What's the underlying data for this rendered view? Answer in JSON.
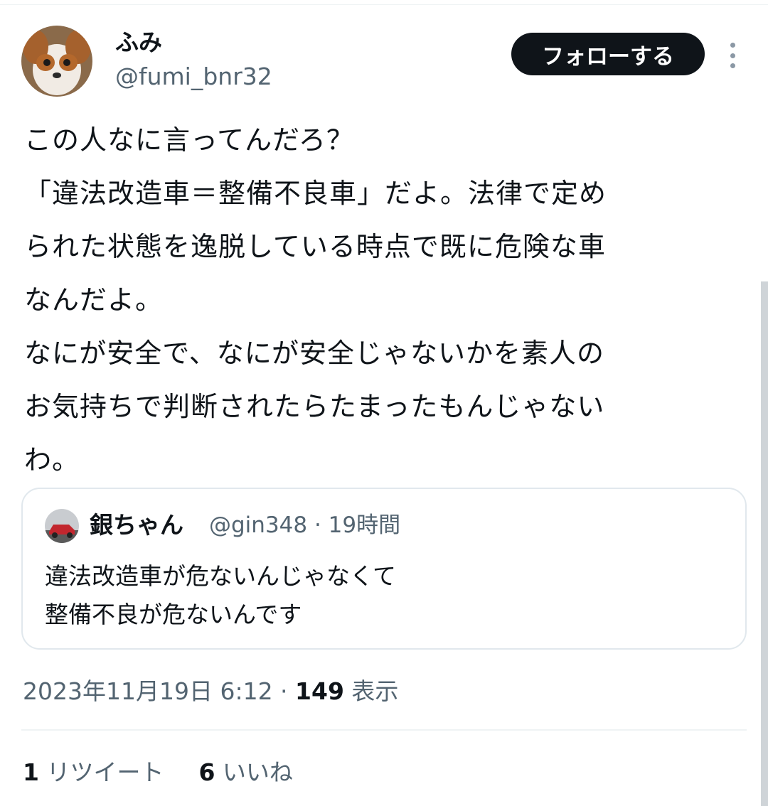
{
  "author": {
    "display_name": "ふみ",
    "handle": "@fumi_bnr32",
    "avatar_icon": "dog-avatar-icon"
  },
  "follow_button": {
    "label": "フォローする"
  },
  "more_button": {
    "icon": "more-vertical-icon"
  },
  "tweet": {
    "lines": [
      "この人なに言ってんだろ？",
      "「違法改造車＝整備不良車」だよ。法律で定め",
      "られた状態を逸脱している時点で既に危険な車",
      "なんだよ。",
      "なにが安全で、なにが安全じゃないかを素人の",
      "お気持ちで判断されたらたまったもんじゃない",
      "わ。"
    ]
  },
  "quote": {
    "display_name": "銀ちゃん",
    "handle_time": "@gin348 · 19時間",
    "avatar_icon": "car-avatar-icon",
    "lines": [
      "違法改造車が危ないんじゃなくて",
      "整備不良が危ないんです"
    ]
  },
  "meta": {
    "timestamp": "2023年11月19日 6:12 · ",
    "views_count": "149",
    "views_label": " 表示"
  },
  "stats": {
    "retweet_count": "1",
    "retweet_label": " リツイート",
    "like_count": "6",
    "like_label": " いいね"
  },
  "colors": {
    "text_primary": "#0f1419",
    "text_secondary": "#536471",
    "border": "#e1e8ed",
    "button_bg": "#0f1419"
  }
}
